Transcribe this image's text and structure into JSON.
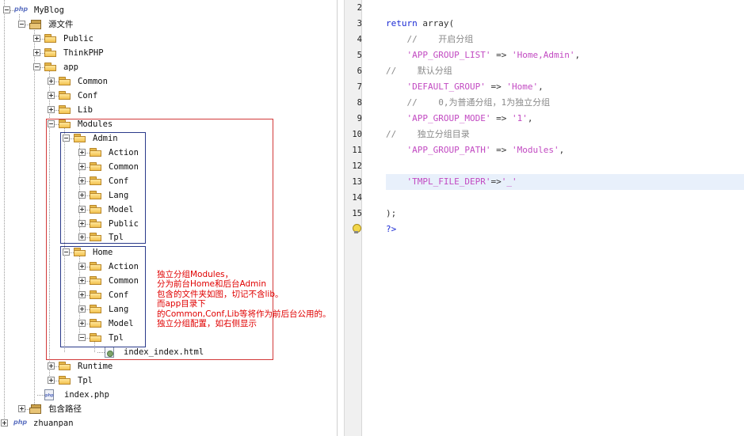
{
  "tree": {
    "nodes": [
      {
        "id": "project-myblog",
        "label": "MyBlog",
        "icon": "php-project-icon"
      },
      {
        "id": "source-files",
        "label": "源文件",
        "icon": "package-icon"
      },
      {
        "id": "public",
        "label": "Public",
        "icon": "folder-icon"
      },
      {
        "id": "thinkphp",
        "label": "ThinkPHP",
        "icon": "folder-icon"
      },
      {
        "id": "app",
        "label": "app",
        "icon": "folder-icon"
      },
      {
        "id": "common",
        "label": "Common",
        "icon": "folder-icon"
      },
      {
        "id": "conf",
        "label": "Conf",
        "icon": "folder-icon"
      },
      {
        "id": "lib",
        "label": "Lib",
        "icon": "folder-icon"
      },
      {
        "id": "modules",
        "label": "Modules",
        "icon": "folder-icon"
      },
      {
        "id": "admin",
        "label": "Admin",
        "icon": "folder-icon"
      },
      {
        "id": "admin-action",
        "label": "Action",
        "icon": "folder-icon"
      },
      {
        "id": "admin-common",
        "label": "Common",
        "icon": "folder-icon"
      },
      {
        "id": "admin-conf",
        "label": "Conf",
        "icon": "folder-icon"
      },
      {
        "id": "admin-lang",
        "label": "Lang",
        "icon": "folder-icon"
      },
      {
        "id": "admin-model",
        "label": "Model",
        "icon": "folder-icon"
      },
      {
        "id": "admin-public",
        "label": "Public",
        "icon": "folder-icon"
      },
      {
        "id": "admin-tpl",
        "label": "Tpl",
        "icon": "folder-icon"
      },
      {
        "id": "home",
        "label": "Home",
        "icon": "folder-icon"
      },
      {
        "id": "home-action",
        "label": "Action",
        "icon": "folder-icon"
      },
      {
        "id": "home-common",
        "label": "Common",
        "icon": "folder-icon"
      },
      {
        "id": "home-conf",
        "label": "Conf",
        "icon": "folder-icon"
      },
      {
        "id": "home-lang",
        "label": "Lang",
        "icon": "folder-icon"
      },
      {
        "id": "home-model",
        "label": "Model",
        "icon": "folder-icon"
      },
      {
        "id": "home-tpl",
        "label": "Tpl",
        "icon": "folder-icon"
      },
      {
        "id": "index-index-html",
        "label": "index_index.html",
        "icon": "html-file-icon"
      },
      {
        "id": "runtime",
        "label": "Runtime",
        "icon": "folder-icon"
      },
      {
        "id": "tpl",
        "label": "Tpl",
        "icon": "folder-icon"
      },
      {
        "id": "index-php",
        "label": "index.php",
        "icon": "php-file-icon"
      },
      {
        "id": "include-path",
        "label": "包含路径",
        "icon": "package-icon"
      },
      {
        "id": "project-zhuanpan",
        "label": "zhuanpan",
        "icon": "php-project-icon"
      }
    ],
    "annotation": [
      "独立分组Modules，",
      "分为前台Home和后台Admin",
      "包含的文件夹如图，切记不含lib。",
      "而app目录下",
      "的Common,Conf,Lib等将作为前后台公用的。",
      "独立分组配置，如右侧显示"
    ],
    "php_badge": "php"
  },
  "editor": {
    "lines": [
      {
        "n": "2",
        "parts": []
      },
      {
        "n": "3",
        "parts": [
          {
            "t": "return ",
            "c": "kw"
          },
          {
            "t": "array(",
            "c": "op"
          }
        ]
      },
      {
        "n": "4",
        "parts": [
          {
            "t": "    //    开启分组",
            "c": "cm"
          }
        ]
      },
      {
        "n": "5",
        "parts": [
          {
            "t": "    ",
            "c": "op"
          },
          {
            "t": "'APP_GROUP_LIST'",
            "c": "str"
          },
          {
            "t": " => ",
            "c": "op"
          },
          {
            "t": "'Home,Admin'",
            "c": "str"
          },
          {
            "t": ",",
            "c": "op"
          }
        ]
      },
      {
        "n": "6",
        "parts": [
          {
            "t": "//    默认分组",
            "c": "cm"
          }
        ]
      },
      {
        "n": "7",
        "parts": [
          {
            "t": "    ",
            "c": "op"
          },
          {
            "t": "'DEFAULT_GROUP'",
            "c": "str"
          },
          {
            "t": " => ",
            "c": "op"
          },
          {
            "t": "'Home'",
            "c": "str"
          },
          {
            "t": ",",
            "c": "op"
          }
        ]
      },
      {
        "n": "8",
        "parts": [
          {
            "t": "    //    0,为普通分组，1为独立分组",
            "c": "cm"
          }
        ]
      },
      {
        "n": "9",
        "parts": [
          {
            "t": "    ",
            "c": "op"
          },
          {
            "t": "'APP_GROUP_MODE'",
            "c": "str"
          },
          {
            "t": " => ",
            "c": "op"
          },
          {
            "t": "'1'",
            "c": "str"
          },
          {
            "t": ",",
            "c": "op"
          }
        ]
      },
      {
        "n": "10",
        "parts": [
          {
            "t": "//    独立分组目录",
            "c": "cm"
          }
        ]
      },
      {
        "n": "11",
        "parts": [
          {
            "t": "    ",
            "c": "op"
          },
          {
            "t": "'APP_GROUP_PATH'",
            "c": "str"
          },
          {
            "t": " => ",
            "c": "op"
          },
          {
            "t": "'Modules'",
            "c": "str"
          },
          {
            "t": ",",
            "c": "op"
          }
        ]
      },
      {
        "n": "12",
        "parts": []
      },
      {
        "n": "13",
        "parts": [
          {
            "t": "    ",
            "c": "op"
          },
          {
            "t": "'TMPL_FILE_DEPR'",
            "c": "str"
          },
          {
            "t": "=>",
            "c": "op"
          },
          {
            "t": "'_'",
            "c": "str"
          }
        ]
      },
      {
        "n": "14",
        "parts": []
      },
      {
        "n": "15",
        "parts": [
          {
            "t": ");",
            "c": "op"
          }
        ]
      },
      {
        "n": "",
        "parts": [
          {
            "t": "?>",
            "c": "kw"
          }
        ]
      }
    ],
    "highlighted_line": "13"
  }
}
